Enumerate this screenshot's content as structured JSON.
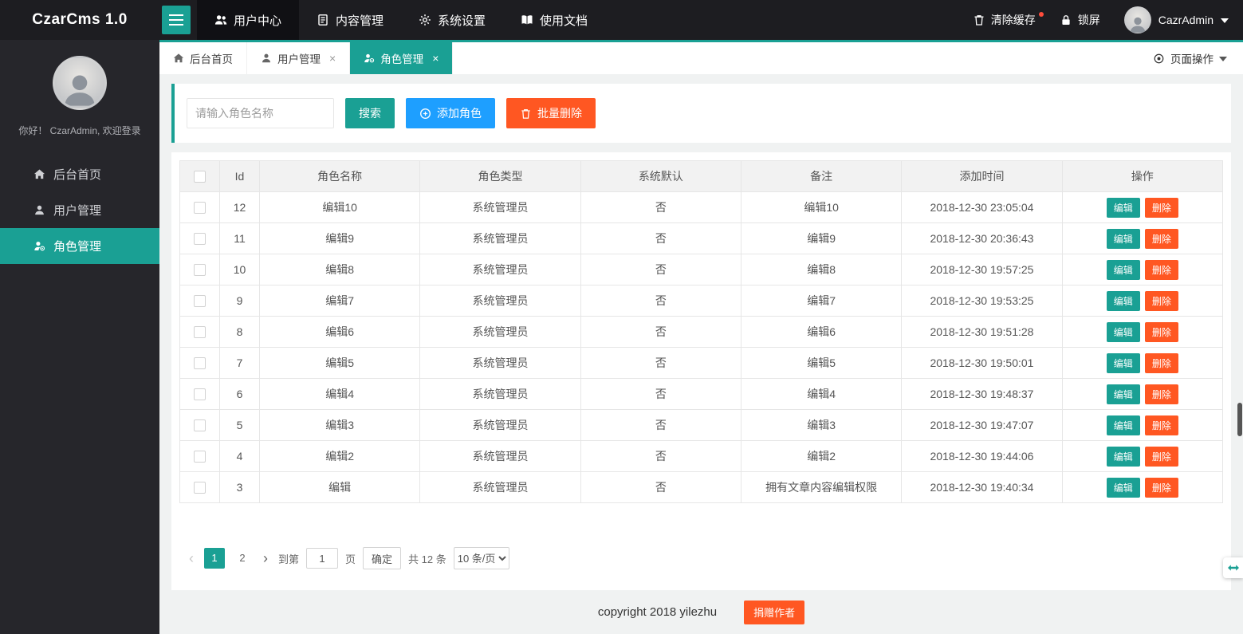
{
  "app": {
    "title": "CzarCms 1.0"
  },
  "topnav": {
    "items": [
      {
        "key": "user-center",
        "label": "用户中心",
        "icon": "users-icon",
        "active": true
      },
      {
        "key": "content-management",
        "label": "内容管理",
        "icon": "content-icon",
        "active": false
      },
      {
        "key": "system-settings",
        "label": "系统设置",
        "icon": "gear-icon",
        "active": false
      },
      {
        "key": "docs",
        "label": "使用文档",
        "icon": "book-icon",
        "active": false
      }
    ],
    "actions": [
      {
        "key": "clear-cache",
        "label": "清除缓存",
        "icon": "trash-icon",
        "badge": true
      },
      {
        "key": "lock-screen",
        "label": "锁屏",
        "icon": "lock-icon",
        "badge": false
      }
    ],
    "user": {
      "name": "CazrAdmin"
    }
  },
  "sidebar": {
    "greeting": "你好！ CzarAdmin, 欢迎登录",
    "items": [
      {
        "key": "home",
        "label": "后台首页",
        "icon": "home-icon",
        "active": false
      },
      {
        "key": "user-management",
        "label": "用户管理",
        "icon": "user-icon",
        "active": false
      },
      {
        "key": "role-management",
        "label": "角色管理",
        "icon": "role-icon",
        "active": true
      }
    ]
  },
  "tabs": [
    {
      "key": "home",
      "label": "后台首页",
      "icon": "home-icon",
      "closable": false,
      "active": false
    },
    {
      "key": "user-management",
      "label": "用户管理",
      "icon": "user-icon",
      "closable": true,
      "active": false
    },
    {
      "key": "role-management",
      "label": "角色管理",
      "icon": "role-icon",
      "closable": true,
      "active": true
    }
  ],
  "page_ops": {
    "label": "页面操作",
    "icon": "target-icon"
  },
  "toolbar": {
    "search_placeholder": "请输入角色名称",
    "search_label": "搜索",
    "add_label": "添加角色",
    "batch_delete_label": "批量删除"
  },
  "table": {
    "headers": [
      "Id",
      "角色名称",
      "角色类型",
      "系统默认",
      "备注",
      "添加时间",
      "操作"
    ],
    "edit_label": "编辑",
    "delete_label": "删除",
    "rows": [
      {
        "id": "12",
        "name": "编辑10",
        "type": "系统管理员",
        "system_default": "否",
        "remark": "编辑10",
        "time": "2018-12-30 23:05:04"
      },
      {
        "id": "11",
        "name": "编辑9",
        "type": "系统管理员",
        "system_default": "否",
        "remark": "编辑9",
        "time": "2018-12-30 20:36:43"
      },
      {
        "id": "10",
        "name": "编辑8",
        "type": "系统管理员",
        "system_default": "否",
        "remark": "编辑8",
        "time": "2018-12-30 19:57:25"
      },
      {
        "id": "9",
        "name": "编辑7",
        "type": "系统管理员",
        "system_default": "否",
        "remark": "编辑7",
        "time": "2018-12-30 19:53:25"
      },
      {
        "id": "8",
        "name": "编辑6",
        "type": "系统管理员",
        "system_default": "否",
        "remark": "编辑6",
        "time": "2018-12-30 19:51:28"
      },
      {
        "id": "7",
        "name": "编辑5",
        "type": "系统管理员",
        "system_default": "否",
        "remark": "编辑5",
        "time": "2018-12-30 19:50:01"
      },
      {
        "id": "6",
        "name": "编辑4",
        "type": "系统管理员",
        "system_default": "否",
        "remark": "编辑4",
        "time": "2018-12-30 19:48:37"
      },
      {
        "id": "5",
        "name": "编辑3",
        "type": "系统管理员",
        "system_default": "否",
        "remark": "编辑3",
        "time": "2018-12-30 19:47:07"
      },
      {
        "id": "4",
        "name": "编辑2",
        "type": "系统管理员",
        "system_default": "否",
        "remark": "编辑2",
        "time": "2018-12-30 19:44:06"
      },
      {
        "id": "3",
        "name": "编辑",
        "type": "系统管理员",
        "system_default": "否",
        "remark": "拥有文章内容编辑权限",
        "time": "2018-12-30 19:40:34"
      }
    ]
  },
  "pagination": {
    "prev_label": "‹",
    "next_label": "›",
    "pages": [
      "1",
      "2"
    ],
    "current": "1",
    "goto_prefix": "到第",
    "goto_value": "1",
    "goto_suffix": "页",
    "confirm_label": "确定",
    "total_label": "共 12 条",
    "per_page_label": "10 条/页"
  },
  "footer": {
    "copyright": "copyright 2018 yilezhu",
    "donate_label": "捐赠作者"
  },
  "float_toggle": {
    "icon": "arrows-h-icon"
  },
  "colors": {
    "accent": "#1aa094",
    "blue": "#1e9fff",
    "orange": "#ff5722",
    "topbar_bg": "#1d1d21",
    "sidebar_bg": "#26262b"
  }
}
